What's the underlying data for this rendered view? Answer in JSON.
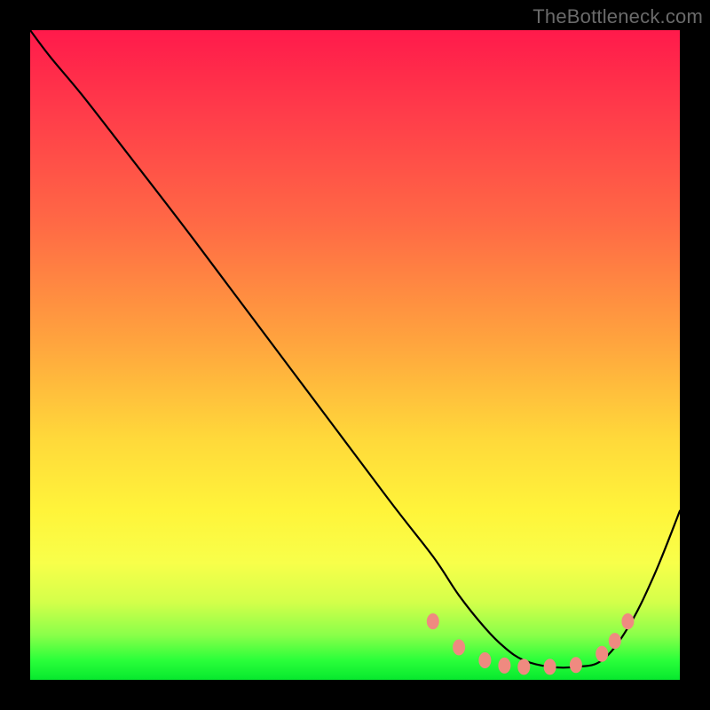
{
  "attribution": "TheBottleneck.com",
  "chart_data": {
    "type": "line",
    "title": "",
    "xlabel": "",
    "ylabel": "",
    "xlim": [
      0,
      100
    ],
    "ylim": [
      0,
      100
    ],
    "series": [
      {
        "name": "bottleneck-curve",
        "x": [
          0,
          3,
          8,
          15,
          25,
          40,
          55,
          62,
          66,
          70,
          73,
          76,
          80,
          84,
          88,
          92,
          96,
          100
        ],
        "values": [
          100,
          96,
          90,
          81,
          68,
          48,
          28,
          19,
          13,
          8,
          5,
          3,
          2,
          2,
          3,
          8,
          16,
          26
        ]
      }
    ],
    "markers": {
      "name": "highlight-dots",
      "color": "#ef8a80",
      "points": [
        {
          "x": 62,
          "y": 9
        },
        {
          "x": 66,
          "y": 5
        },
        {
          "x": 70,
          "y": 3
        },
        {
          "x": 73,
          "y": 2.2
        },
        {
          "x": 76,
          "y": 2
        },
        {
          "x": 80,
          "y": 2
        },
        {
          "x": 84,
          "y": 2.3
        },
        {
          "x": 88,
          "y": 4
        },
        {
          "x": 90,
          "y": 6
        },
        {
          "x": 92,
          "y": 9
        }
      ]
    }
  }
}
